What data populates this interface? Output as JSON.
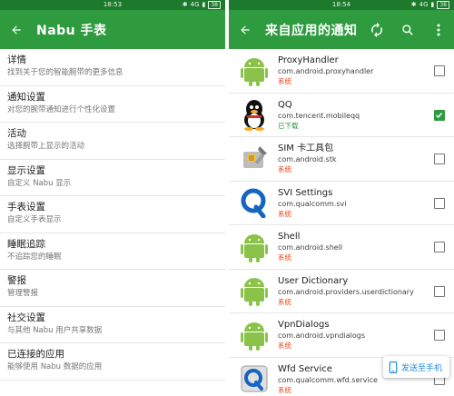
{
  "left": {
    "status": {
      "time": "18:53",
      "network": "4G",
      "battery": "38"
    },
    "toolbar": {
      "title": "Nabu 手表",
      "back_icon": "arrow-left-icon"
    },
    "items": [
      {
        "title": "详情",
        "subtitle": "找到关于您的智能腕带的更多信息"
      },
      {
        "title": "通知设置",
        "subtitle": "对您的腕带通知进行个性化设置"
      },
      {
        "title": "活动",
        "subtitle": "选择腕带上显示的活动"
      },
      {
        "title": "显示设置",
        "subtitle": "自定义 Nabu 显示"
      },
      {
        "title": "手表设置",
        "subtitle": "自定义手表显示"
      },
      {
        "title": "睡眠追踪",
        "subtitle": "不追踪您的睡眠"
      },
      {
        "title": "警报",
        "subtitle": "管理警报"
      },
      {
        "title": "社交设置",
        "subtitle": "与其他 Nabu 用户共享数据"
      },
      {
        "title": "已连接的应用",
        "subtitle": "能够使用 Nabu 数据的应用"
      }
    ]
  },
  "right": {
    "status": {
      "time": "18:54",
      "network": "4G",
      "battery": "38"
    },
    "toolbar": {
      "title": "来自应用的通知",
      "back_icon": "arrow-left-icon",
      "refresh_icon": "refresh-icon",
      "search_icon": "search-icon",
      "more_icon": "more-vert-icon"
    },
    "apps": [
      {
        "name": "ProxyHandler",
        "package": "com.android.proxyhandler",
        "tag": "系统",
        "tag_type": "system",
        "checked": false,
        "icon": "android-icon"
      },
      {
        "name": "QQ",
        "package": "com.tencent.mobileqq",
        "tag": "已下载",
        "tag_type": "downloaded",
        "checked": true,
        "icon": "qq-penguin-icon"
      },
      {
        "name": "SIM 卡工具包",
        "package": "com.android.stk",
        "tag": "系统",
        "tag_type": "system",
        "checked": false,
        "icon": "sim-toolkit-icon"
      },
      {
        "name": "SVI Settings",
        "package": "com.qualcomm.svi",
        "tag": "系统",
        "tag_type": "system",
        "checked": false,
        "icon": "qualcomm-q-icon"
      },
      {
        "name": "Shell",
        "package": "com.android.shell",
        "tag": "系统",
        "tag_type": "system",
        "checked": false,
        "icon": "android-icon"
      },
      {
        "name": "User Dictionary",
        "package": "com.android.providers.userdictionary",
        "tag": "系统",
        "tag_type": "system",
        "checked": false,
        "icon": "android-icon"
      },
      {
        "name": "VpnDialogs",
        "package": "com.android.vpndialogs",
        "tag": "系统",
        "tag_type": "system",
        "checked": false,
        "icon": "android-icon"
      },
      {
        "name": "Wfd Service",
        "package": "com.qualcomm.wfd.service",
        "tag": "系统",
        "tag_type": "system",
        "checked": false,
        "icon": "wfd-q-icon"
      }
    ],
    "send_button": {
      "label": "发送至手机",
      "icon": "phone-icon"
    }
  },
  "colors": {
    "primary": "#2e9b3f",
    "primary_dark": "#1d7a2c",
    "system_tag": "#e64a19",
    "android_green": "#8bc34a",
    "send_blue": "#1e88e5"
  }
}
